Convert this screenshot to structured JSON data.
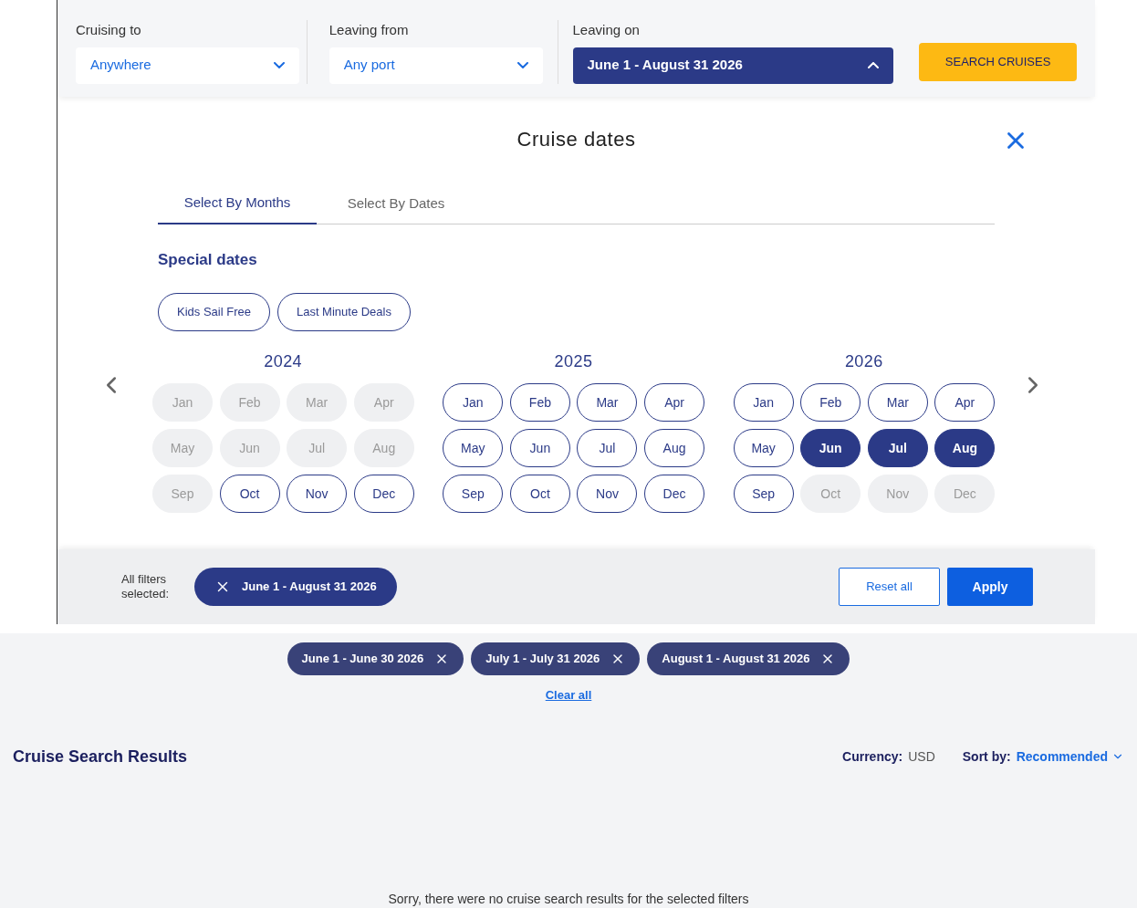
{
  "search_bar": {
    "fields": [
      {
        "label": "Cruising to",
        "value": "Anywhere",
        "open": false
      },
      {
        "label": "Leaving from",
        "value": "Any port",
        "open": false
      },
      {
        "label": "Leaving on",
        "value": "June 1 - August 31 2026",
        "open": true
      }
    ],
    "button": "SEARCH CRUISES"
  },
  "dialog": {
    "title": "Cruise dates",
    "tabs": [
      {
        "label": "Select By Months",
        "selected": true
      },
      {
        "label": "Select By Dates",
        "selected": false
      }
    ],
    "special_dates": {
      "heading": "Special dates",
      "options": [
        {
          "label": "Kids Sail Free",
          "selected": false
        },
        {
          "label": "Last Minute Deals",
          "selected": false
        }
      ]
    },
    "years": [
      {
        "year": "2024",
        "months": [
          {
            "label": "Jan",
            "disabled": true,
            "selected": false
          },
          {
            "label": "Feb",
            "disabled": true,
            "selected": false
          },
          {
            "label": "Mar",
            "disabled": true,
            "selected": false
          },
          {
            "label": "Apr",
            "disabled": true,
            "selected": false
          },
          {
            "label": "May",
            "disabled": true,
            "selected": false
          },
          {
            "label": "Jun",
            "disabled": true,
            "selected": false
          },
          {
            "label": "Jul",
            "disabled": true,
            "selected": false
          },
          {
            "label": "Aug",
            "disabled": true,
            "selected": false
          },
          {
            "label": "Sep",
            "disabled": true,
            "selected": false
          },
          {
            "label": "Oct",
            "disabled": false,
            "selected": false
          },
          {
            "label": "Nov",
            "disabled": false,
            "selected": false
          },
          {
            "label": "Dec",
            "disabled": false,
            "selected": false
          }
        ]
      },
      {
        "year": "2025",
        "months": [
          {
            "label": "Jan",
            "disabled": false,
            "selected": false
          },
          {
            "label": "Feb",
            "disabled": false,
            "selected": false
          },
          {
            "label": "Mar",
            "disabled": false,
            "selected": false
          },
          {
            "label": "Apr",
            "disabled": false,
            "selected": false
          },
          {
            "label": "May",
            "disabled": false,
            "selected": false
          },
          {
            "label": "Jun",
            "disabled": false,
            "selected": false
          },
          {
            "label": "Jul",
            "disabled": false,
            "selected": false
          },
          {
            "label": "Aug",
            "disabled": false,
            "selected": false
          },
          {
            "label": "Sep",
            "disabled": false,
            "selected": false
          },
          {
            "label": "Oct",
            "disabled": false,
            "selected": false
          },
          {
            "label": "Nov",
            "disabled": false,
            "selected": false
          },
          {
            "label": "Dec",
            "disabled": false,
            "selected": false
          }
        ]
      },
      {
        "year": "2026",
        "months": [
          {
            "label": "Jan",
            "disabled": false,
            "selected": false
          },
          {
            "label": "Feb",
            "disabled": false,
            "selected": false
          },
          {
            "label": "Mar",
            "disabled": false,
            "selected": false
          },
          {
            "label": "Apr",
            "disabled": false,
            "selected": false
          },
          {
            "label": "May",
            "disabled": false,
            "selected": false
          },
          {
            "label": "Jun",
            "disabled": false,
            "selected": true
          },
          {
            "label": "Jul",
            "disabled": false,
            "selected": true
          },
          {
            "label": "Aug",
            "disabled": false,
            "selected": true
          },
          {
            "label": "Sep",
            "disabled": false,
            "selected": false
          },
          {
            "label": "Oct",
            "disabled": true,
            "selected": false
          },
          {
            "label": "Nov",
            "disabled": true,
            "selected": false
          },
          {
            "label": "Dec",
            "disabled": true,
            "selected": false
          }
        ]
      }
    ],
    "footer": {
      "label": "All filters selected:",
      "chips": [
        "June 1 - August 31 2026"
      ],
      "reset": "Reset all",
      "apply": "Apply"
    }
  },
  "applied_filters": {
    "chips": [
      "June 1 - June 30 2026",
      "July 1 - July 31 2026",
      "August 1 - August 31 2026"
    ],
    "clear": "Clear all"
  },
  "results": {
    "title": "Cruise Search Results",
    "currency_label": "Currency:",
    "currency": "USD",
    "sort_label": "Sort by:",
    "sort_value": "Recommended",
    "message": "Sorry, there were no cruise search results for the selected filters"
  }
}
